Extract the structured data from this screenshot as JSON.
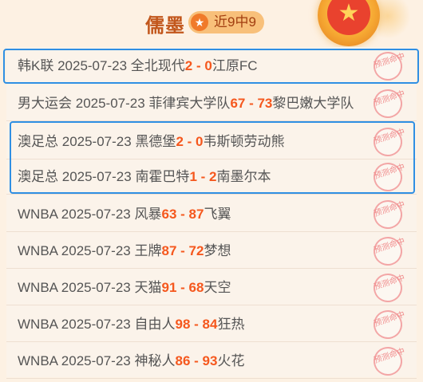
{
  "header": {
    "author": "儒墨",
    "star_glyph": "★",
    "record": "近9中9",
    "medal_glyph": "★"
  },
  "stamp_text": "预测命中",
  "rows": [
    {
      "league": "韩K联",
      "date": "2025-07-23",
      "home": "全北现代",
      "home_score": "2",
      "sep": " - ",
      "away_score": "0",
      "away": "江原FC"
    },
    {
      "league": "男大运会",
      "date": "2025-07-23",
      "home": "菲律宾大学队",
      "home_score": "67",
      "sep": " - ",
      "away_score": "73",
      "away": "黎巴嫩大学队"
    },
    {
      "league": "澳足总",
      "date": "2025-07-23",
      "home": "黑德堡",
      "home_score": "2",
      "sep": " - ",
      "away_score": "0",
      "away": "韦斯顿劳动熊"
    },
    {
      "league": "澳足总",
      "date": "2025-07-23",
      "home": "南霍巴特",
      "home_score": "1",
      "sep": " - ",
      "away_score": "2",
      "away": "南墨尔本"
    },
    {
      "league": "WNBA",
      "date": "2025-07-23",
      "home": "风暴",
      "home_score": "63",
      "sep": " - ",
      "away_score": "87",
      "away": "飞翼"
    },
    {
      "league": "WNBA",
      "date": "2025-07-23",
      "home": "王牌",
      "home_score": "87",
      "sep": " - ",
      "away_score": "72",
      "away": "梦想"
    },
    {
      "league": "WNBA",
      "date": "2025-07-23",
      "home": "天猫",
      "home_score": "91",
      "sep": " - ",
      "away_score": "68",
      "away": "天空"
    },
    {
      "league": "WNBA",
      "date": "2025-07-23",
      "home": "自由人",
      "home_score": "98",
      "sep": " - ",
      "away_score": "84",
      "away": "狂热"
    },
    {
      "league": "WNBA",
      "date": "2025-07-23",
      "home": "神秘人",
      "home_score": "86",
      "sep": " - ",
      "away_score": "93",
      "away": "火花"
    }
  ]
}
